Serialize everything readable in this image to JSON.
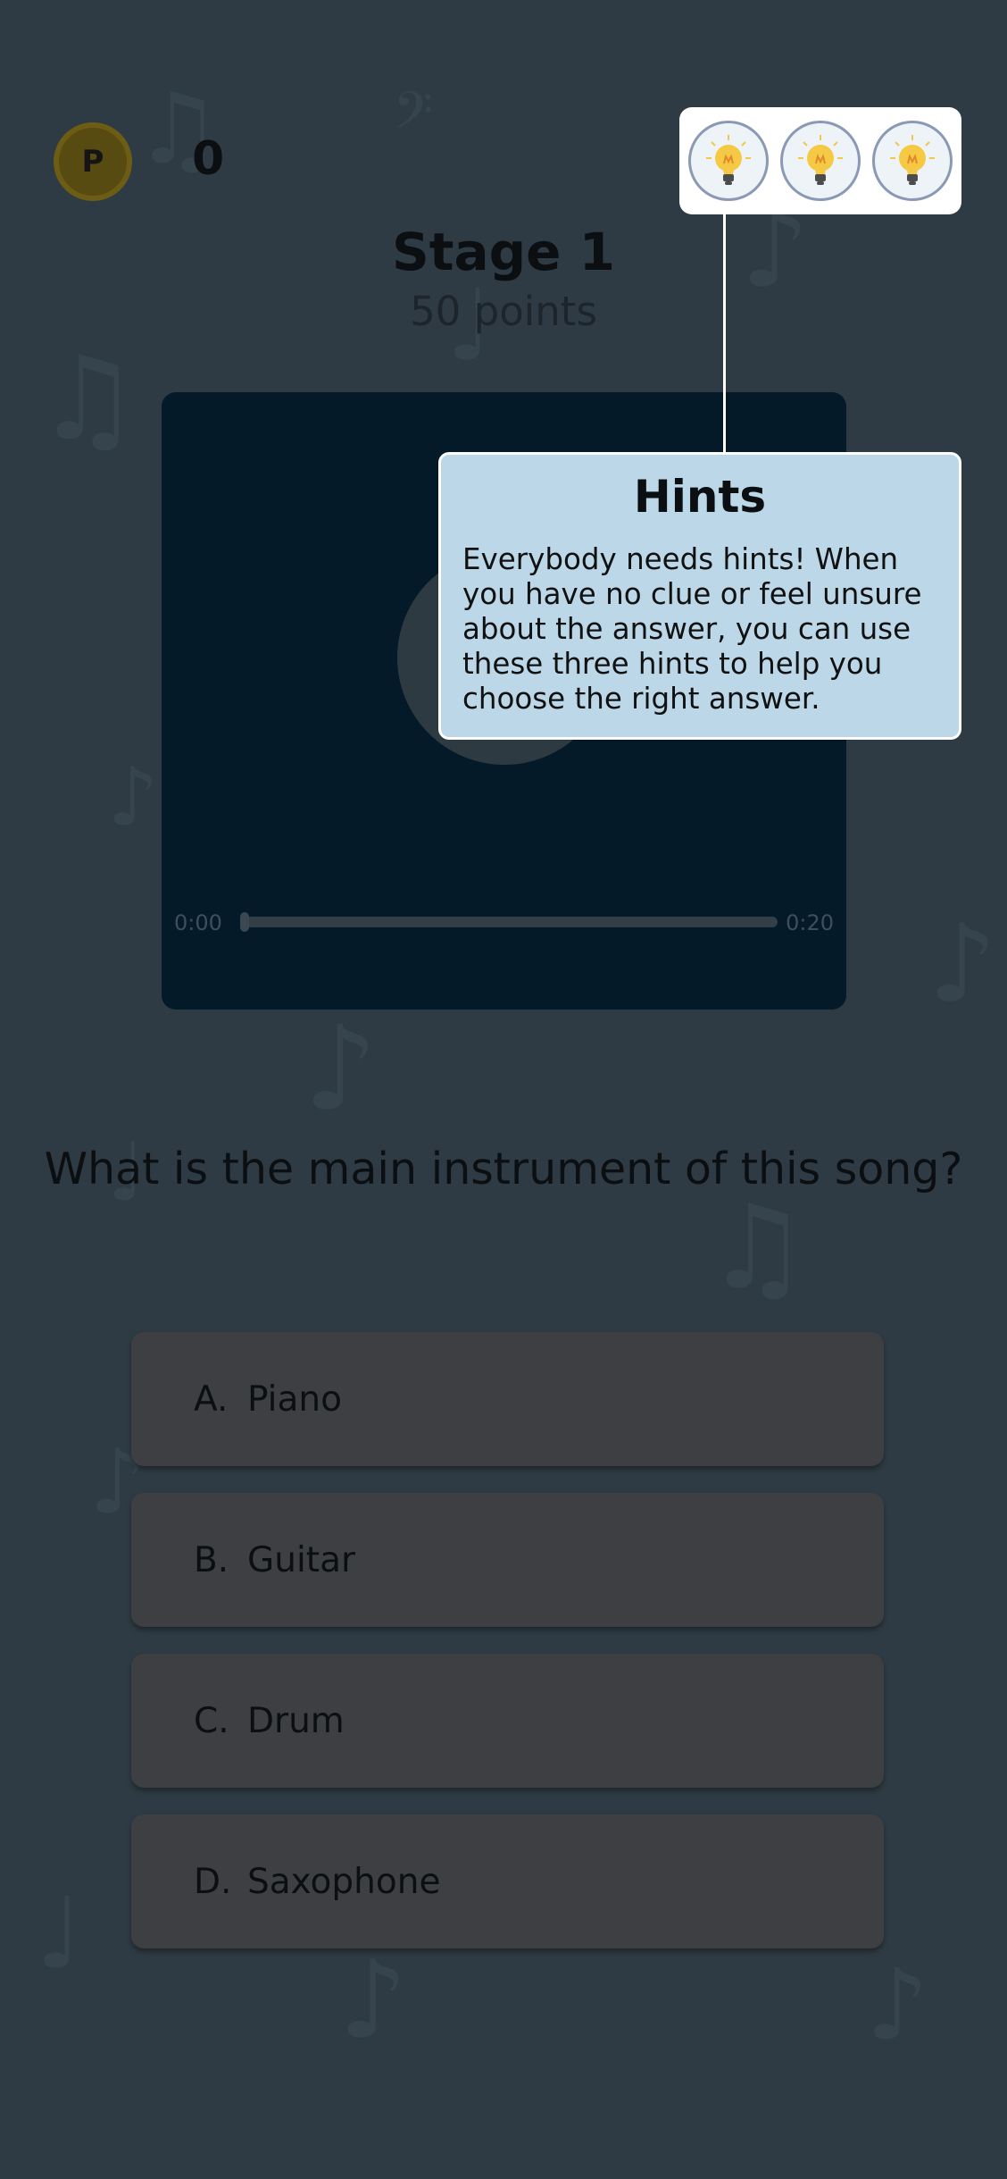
{
  "header": {
    "coin_label": "P",
    "score": "0"
  },
  "stage": {
    "title": "Stage 1",
    "points": "50 points"
  },
  "hints": {
    "icons": [
      "lightbulb-icon",
      "lightbulb-icon",
      "lightbulb-icon"
    ],
    "tooltip_title": "Hints",
    "tooltip_body": "Everybody needs hints! When you have no clue or feel unsure about the answer, you can use these three hints to help you choose the right answer."
  },
  "player": {
    "current_time": "0:00",
    "duration": "0:20",
    "progress": 0
  },
  "question": {
    "text": "What is the main instrument of this song?",
    "options": [
      {
        "letter": "A.",
        "label": "Piano"
      },
      {
        "letter": "B.",
        "label": "Guitar"
      },
      {
        "letter": "C.",
        "label": "Drum"
      },
      {
        "letter": "D.",
        "label": "Saxophone"
      }
    ]
  },
  "colors": {
    "overlay_bg": "#2f3b44",
    "tooltip_bg": "#bcd8e8",
    "player_bg": "#051a28",
    "coin": "#574b12"
  }
}
